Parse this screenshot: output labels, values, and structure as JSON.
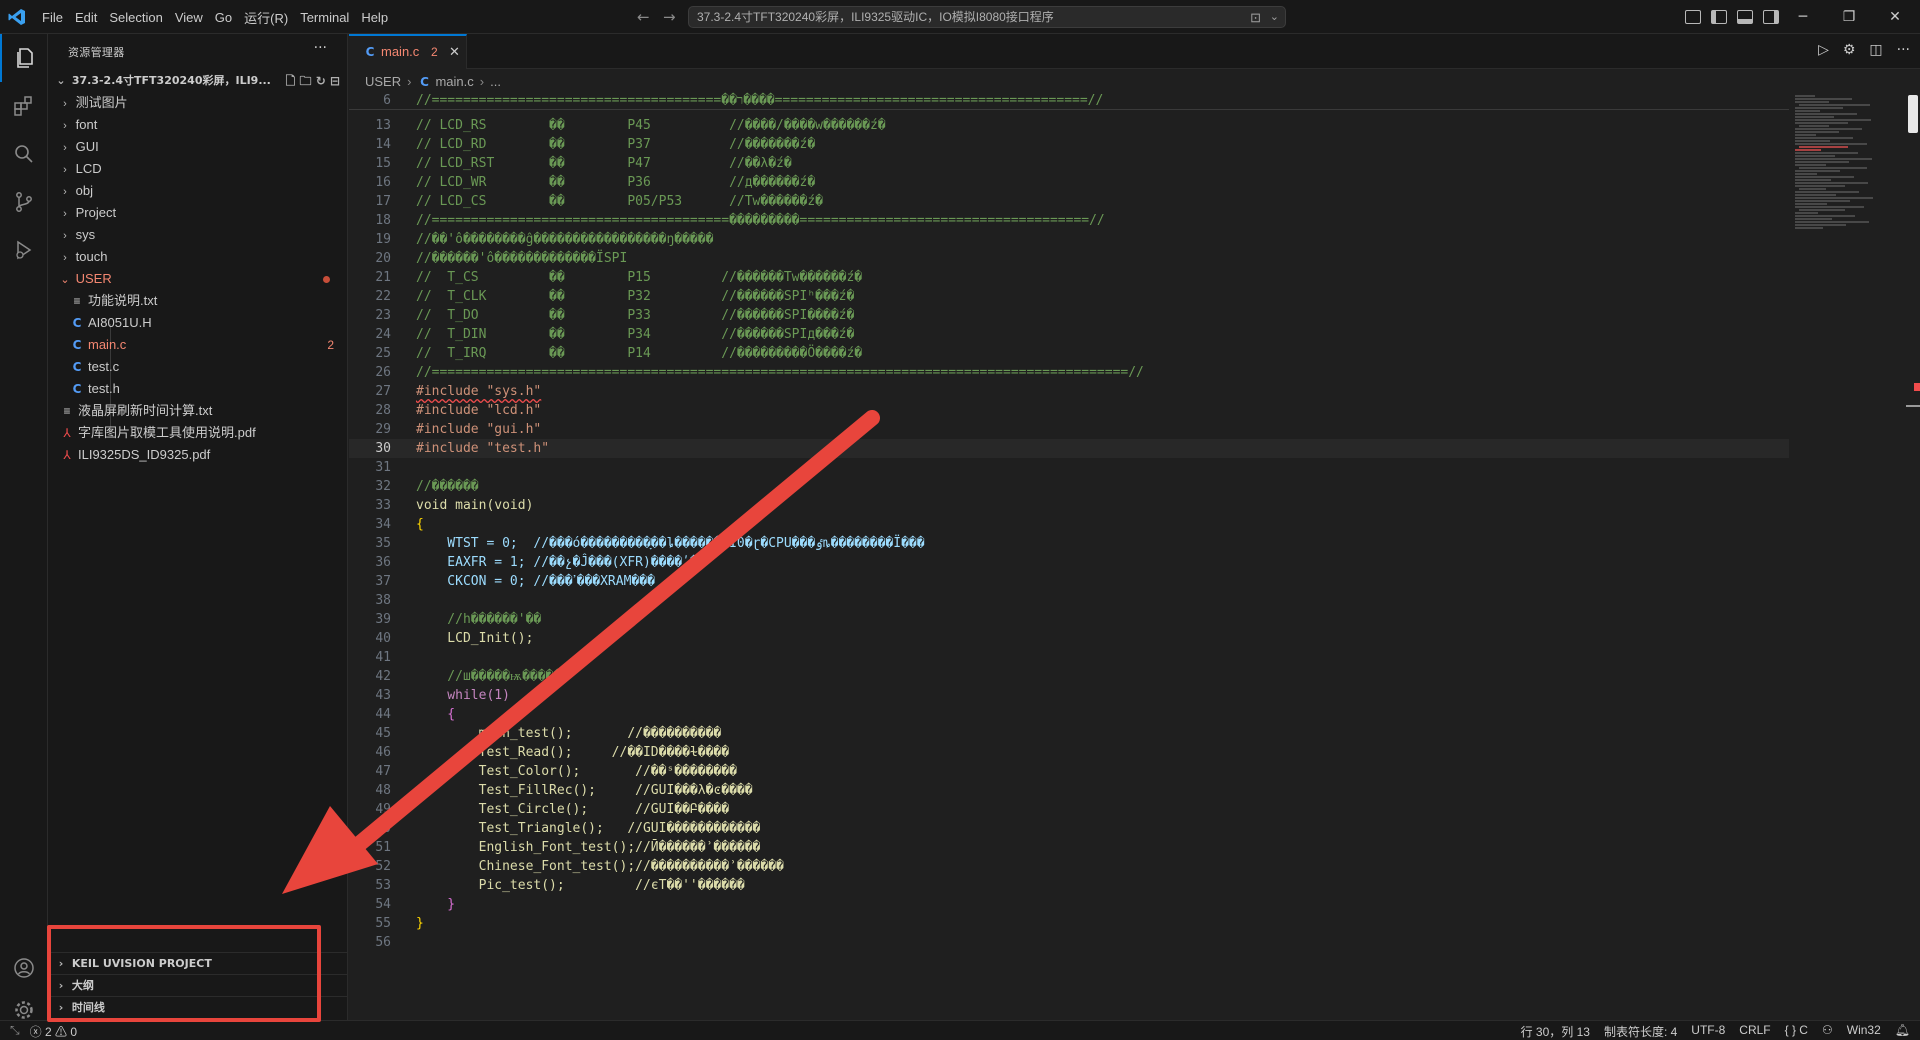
{
  "titlebar": {
    "menu": [
      "File",
      "Edit",
      "Selection",
      "View",
      "Go",
      "运行(R)",
      "Terminal",
      "Help"
    ],
    "search_text": "37.3-2.4寸TFT320240彩屏，ILI9325驱动IC，IO模拟I8080接口程序"
  },
  "sidebar": {
    "header": "资源管理器",
    "root_label": "37.3-2.4寸TFT320240彩屏，ILI9...",
    "folders": [
      "测试图片",
      "font",
      "GUI",
      "LCD",
      "obj",
      "Project",
      "sys",
      "touch"
    ],
    "user_folder": "USER",
    "user_files": [
      {
        "name": "功能说明.txt",
        "type": "txt"
      },
      {
        "name": "AI8051U.H",
        "type": "c"
      },
      {
        "name": "main.c",
        "type": "c",
        "badge": "2"
      },
      {
        "name": "test.c",
        "type": "c"
      },
      {
        "name": "test.h",
        "type": "c"
      }
    ],
    "root_files": [
      {
        "name": "液晶屏刷新时间计算.txt",
        "type": "txt"
      },
      {
        "name": "字库图片取模工具使用说明.pdf",
        "type": "pdf"
      },
      {
        "name": "ILI9325DS_ID9325.pdf",
        "type": "pdf"
      }
    ],
    "sections": [
      "KEIL UVISION PROJECT",
      "大纲",
      "时间线"
    ]
  },
  "editor": {
    "tab_label": "main.c",
    "tab_badge": "2",
    "breadcrumb": [
      "USER",
      "main.c",
      "..."
    ],
    "sticky_line": {
      "n": "6",
      "text": "//=====================================��ר����========================================//"
    },
    "lines": [
      {
        "n": "13",
        "text": "// LCD_RS        ��        P45          //����/����w������ź�"
      },
      {
        "n": "14",
        "text": "// LCD_RD        ��        P37          //�������ź�"
      },
      {
        "n": "15",
        "text": "// LCD_RST       ��        P47          //��λ�ź�"
      },
      {
        "n": "16",
        "text": "// LCD_WR        ��        P36          //д������ź�"
      },
      {
        "n": "17",
        "text": "// LCD_CS        ��        P05/P53      //Tw������ź�"
      },
      {
        "n": "18",
        "text": "//======================================���������=====================================//"
      },
      {
        "n": "19",
        "text": "//��'ô��������ĝ�����������������ŋ�����"
      },
      {
        "n": "20",
        "text": "//������'ô�������������ÏSPI"
      },
      {
        "n": "21",
        "text": "//  T_CS         ��        P15         //������Tw������ź�"
      },
      {
        "n": "22",
        "text": "//  T_CLK        ��        P32         //������SPIʰ���ź�"
      },
      {
        "n": "23",
        "text": "//  T_DO         ��        P33         //������SPI����ź�"
      },
      {
        "n": "24",
        "text": "//  T_DIN        ��        P34         //������SPIд���ź�"
      },
      {
        "n": "25",
        "text": "//  T_IRQ        ��        P14         //���������Ö����ź�"
      },
      {
        "n": "26",
        "text": "//=========================================================================================//"
      },
      {
        "n": "27",
        "text": "#include \"sys.h\""
      },
      {
        "n": "28",
        "text": "#include \"lcd.h\""
      },
      {
        "n": "29",
        "text": "#include \"gui.h\""
      },
      {
        "n": "30",
        "text": "#include \"test.h\""
      },
      {
        "n": "31",
        "text": ""
      },
      {
        "n": "32",
        "text": "//������"
      },
      {
        "n": "33",
        "text": "void main(void)"
      },
      {
        "n": "34",
        "text": "{"
      },
      {
        "n": "35",
        "text": "    WTST = 0;  //���ó���������ָ��ȴ�������Ï0�ɽ�CPUִ���ٶȵ��������Ï���"
      },
      {
        "n": "36",
        "text": "    EAXFR = 1; //��չ�Ĵ���(XFR)����ʹ��"
      },
      {
        "n": "37",
        "text": "    CKCON = 0; //���ߴ���XRAM���"
      },
      {
        "n": "38",
        "text": ""
      },
      {
        "n": "39",
        "text": "    //h������'��"
      },
      {
        "n": "40",
        "text": "    LCD_Init();"
      },
      {
        "n": "41",
        "text": ""
      },
      {
        "n": "42",
        "text": "    //ш�����ѭ������"
      },
      {
        "n": "43",
        "text": "    while(1)"
      },
      {
        "n": "44",
        "text": "    {"
      },
      {
        "n": "45",
        "text": "        main_test();       //����������"
      },
      {
        "n": "46",
        "text": "        Test_Read();     //��ID����ɫ����"
      },
      {
        "n": "47",
        "text": "        Test_Color();       //��ˢ��������"
      },
      {
        "n": "48",
        "text": "        Test_FillRec();     //GUI���λ�ͼ����"
      },
      {
        "n": "49",
        "text": "        Test_Circle();      //GUI��Բ����"
      },
      {
        "n": "50",
        "text": "        Test_Triangle();   //GUI������������"
      },
      {
        "n": "51",
        "text": "        English_Font_test();//Ӣ������ʾ������"
      },
      {
        "n": "52",
        "text": "        Chinese_Font_test();//����������ʾ������"
      },
      {
        "n": "53",
        "text": "        Pic_test();         //єT��''������"
      },
      {
        "n": "54",
        "text": "    }"
      },
      {
        "n": "55",
        "text": "}"
      },
      {
        "n": "56",
        "text": ""
      }
    ]
  },
  "statusbar": {
    "errors": "2",
    "warnings": "0",
    "position": "行 30，列 13",
    "tab_size": "制表符长度: 4",
    "encoding": "UTF-8",
    "eol": "CRLF",
    "language": "{ } C",
    "platform": "Win32"
  },
  "colors": {
    "accent": "#0078d4",
    "annotation": "#e8453c",
    "error": "#f14c4c"
  }
}
